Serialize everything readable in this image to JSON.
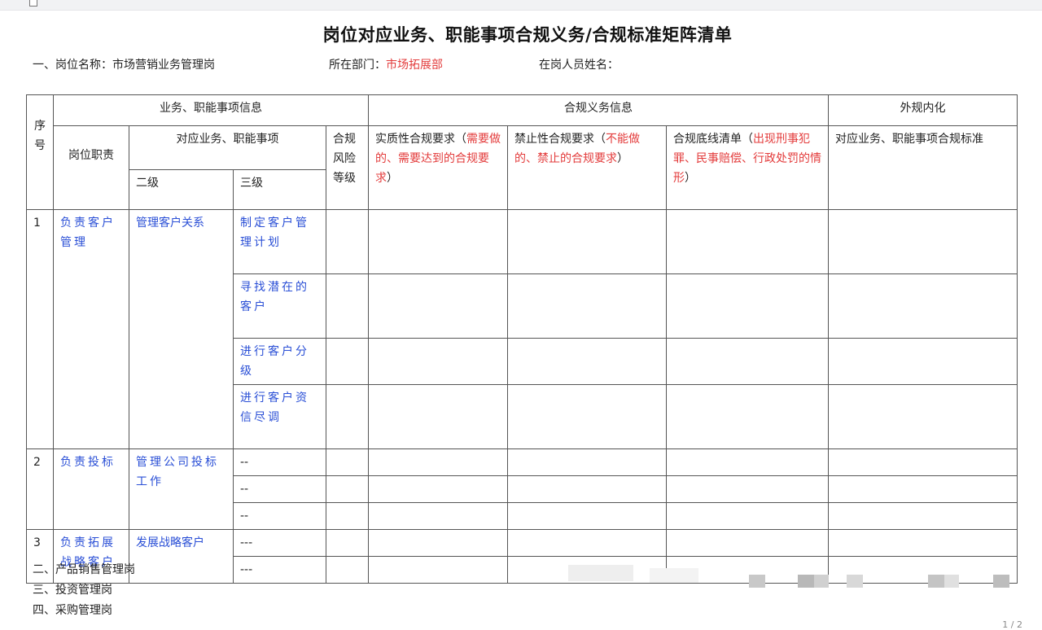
{
  "document": {
    "title": "岗位对应业务、职能事项合规义务/合规标准矩阵清单",
    "position": {
      "label": "一、岗位名称：",
      "value": "市场营销业务管理岗"
    },
    "department": {
      "label": "所在部门：",
      "value": "市场拓展部"
    },
    "staff": {
      "label": "在岗人员姓名："
    },
    "page_number": "1 / 2"
  },
  "table": {
    "group_headers": {
      "seq": "序号",
      "business_info": "业务、职能事项信息",
      "compliance_info": "合规义务信息",
      "external_internal": "外规内化"
    },
    "col_headers": {
      "duty": "岗位职责",
      "matters": "对应业务、职能事项",
      "level2": "二级",
      "level3": "三级",
      "risk_level": "合规风险等级",
      "substantive": {
        "prefix": "实质性合规要求（",
        "red": "需要做的、需要达到的合规要求",
        "suffix": "）"
      },
      "prohibited": {
        "prefix": "禁止性合规要求（",
        "red": "不能做的、禁止的合规要求",
        "suffix": "）"
      },
      "bottom_line": {
        "prefix": "合规底线清单（",
        "red": "出现刑事犯罪、民事赔偿、行政处罚的情形",
        "suffix": "）"
      },
      "standards": "对应业务、职能事项合规标准"
    },
    "groups": [
      {
        "no": "1",
        "duty": "负责客户管理",
        "level2": "管理客户关系",
        "items": [
          "制定客户管理计划",
          "寻找潜在的客户",
          "进行客户分级",
          "进行客户资信尽调"
        ]
      },
      {
        "no": "2",
        "duty": "负责投标",
        "level2": "管理公司投标工作",
        "items": [
          "--",
          "--",
          "--"
        ]
      },
      {
        "no": "3",
        "duty": "负责拓展战略客户",
        "level2": "发展战略客户",
        "items": [
          "---",
          "---"
        ]
      }
    ]
  },
  "sections_below": [
    "二、产品销售管理岗",
    "三、投资管理岗",
    "四、采购管理岗"
  ]
}
